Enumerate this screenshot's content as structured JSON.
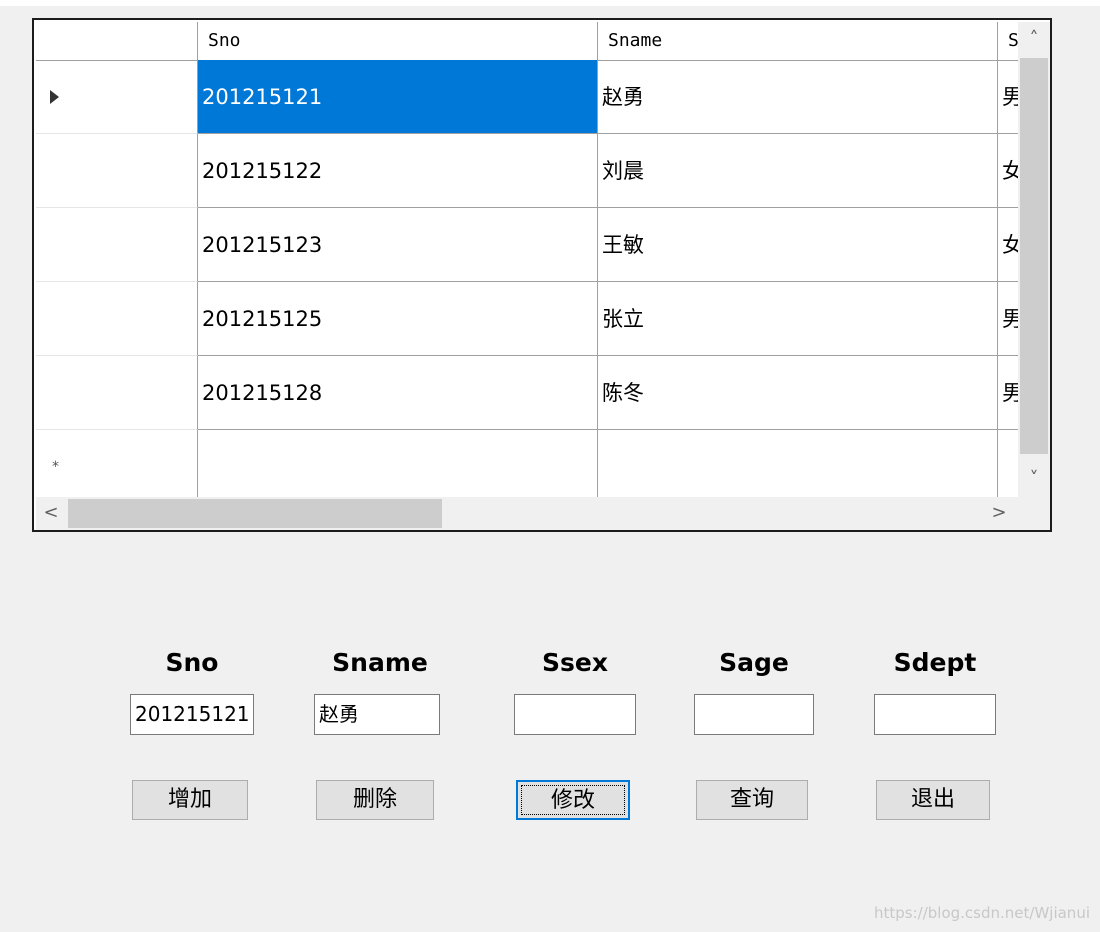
{
  "grid": {
    "columns": [
      "",
      "Sno",
      "Sname",
      "S"
    ],
    "rows": [
      {
        "sno": "201215121",
        "sname": "赵勇",
        "ssex": "男"
      },
      {
        "sno": "201215122",
        "sname": "刘晨",
        "ssex": "女"
      },
      {
        "sno": "201215123",
        "sname": "王敏",
        "ssex": "女"
      },
      {
        "sno": "201215125",
        "sname": "张立",
        "ssex": "男"
      },
      {
        "sno": "201215128",
        "sname": "陈冬",
        "ssex": "男"
      }
    ],
    "selected_row": 0,
    "new_row_marker": "*",
    "current_row_marker": "▶"
  },
  "scrollbars": {
    "up_icon": "chevron-up-icon",
    "down_icon": "chevron-down-icon",
    "left_icon": "chevron-left-icon",
    "right_icon": "chevron-right-icon",
    "up_glyph": "˄",
    "down_glyph": "˅",
    "left_glyph": "<",
    "right_glyph": ">"
  },
  "form": {
    "labels": {
      "sno": "Sno",
      "sname": "Sname",
      "ssex": "Ssex",
      "sage": "Sage",
      "sdept": "Sdept"
    },
    "values": {
      "sno": "201215121",
      "sname": "赵勇",
      "ssex": "",
      "sage": "",
      "sdept": ""
    }
  },
  "buttons": {
    "add": "增加",
    "delete": "删除",
    "modify": "修改",
    "query": "查询",
    "exit": "退出"
  },
  "watermark": "https://blog.csdn.net/Wjianui",
  "colors": {
    "selection": "#0078d7",
    "background": "#f0f0f0",
    "focus_border": "#0078d7"
  }
}
